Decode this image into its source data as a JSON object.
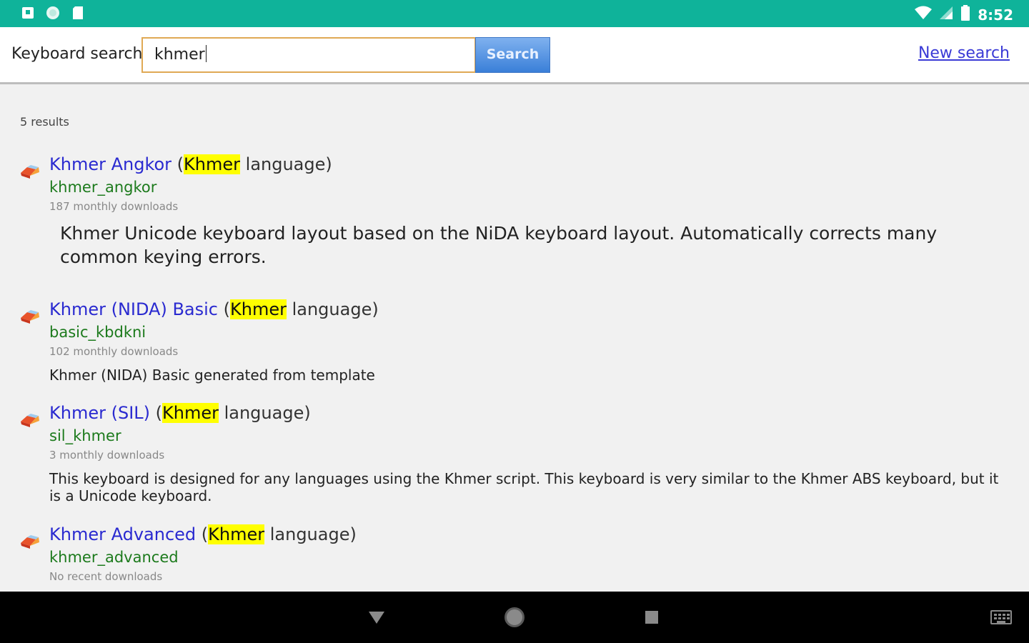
{
  "status_bar": {
    "time": "8:52",
    "icons": [
      "app-notification-icon",
      "circle-notification-icon",
      "sd-card-icon",
      "wifi-icon",
      "signal-icon",
      "battery-icon"
    ],
    "color": "#0fb39a"
  },
  "search": {
    "label": "Keyboard search:",
    "value": "khmer",
    "button_label": "Search",
    "new_search_label": "New search"
  },
  "results": {
    "count_text": "5 results",
    "items": [
      {
        "name": "Khmer Angkor",
        "lang_open": " (",
        "lang_highlight": "Khmer",
        "lang_close": " language)",
        "id": "khmer_angkor",
        "downloads": "187 monthly downloads",
        "description": "Khmer Unicode keyboard layout based on the NiDA keyboard layout. Automatically corrects many common keying errors."
      },
      {
        "name": "Khmer (NIDA) Basic",
        "lang_open": " (",
        "lang_highlight": "Khmer",
        "lang_close": " language)",
        "id": "basic_kbdkni",
        "downloads": "102 monthly downloads",
        "description": "Khmer (NIDA) Basic generated from template"
      },
      {
        "name": "Khmer (SIL)",
        "lang_open": " (",
        "lang_highlight": "Khmer",
        "lang_close": " language)",
        "id": "sil_khmer",
        "downloads": "3 monthly downloads",
        "description": "This keyboard is designed for any languages using the Khmer script. This keyboard is very similar to the Khmer ABS keyboard, but it is a Unicode keyboard."
      },
      {
        "name": "Khmer Advanced",
        "lang_open": " (",
        "lang_highlight": "Khmer",
        "lang_close": " language)",
        "id": "khmer_advanced",
        "downloads": "No recent downloads"
      }
    ]
  },
  "nav_bar": {
    "icons": [
      "back-icon",
      "home-icon",
      "recents-icon",
      "keyboard-icon"
    ]
  }
}
